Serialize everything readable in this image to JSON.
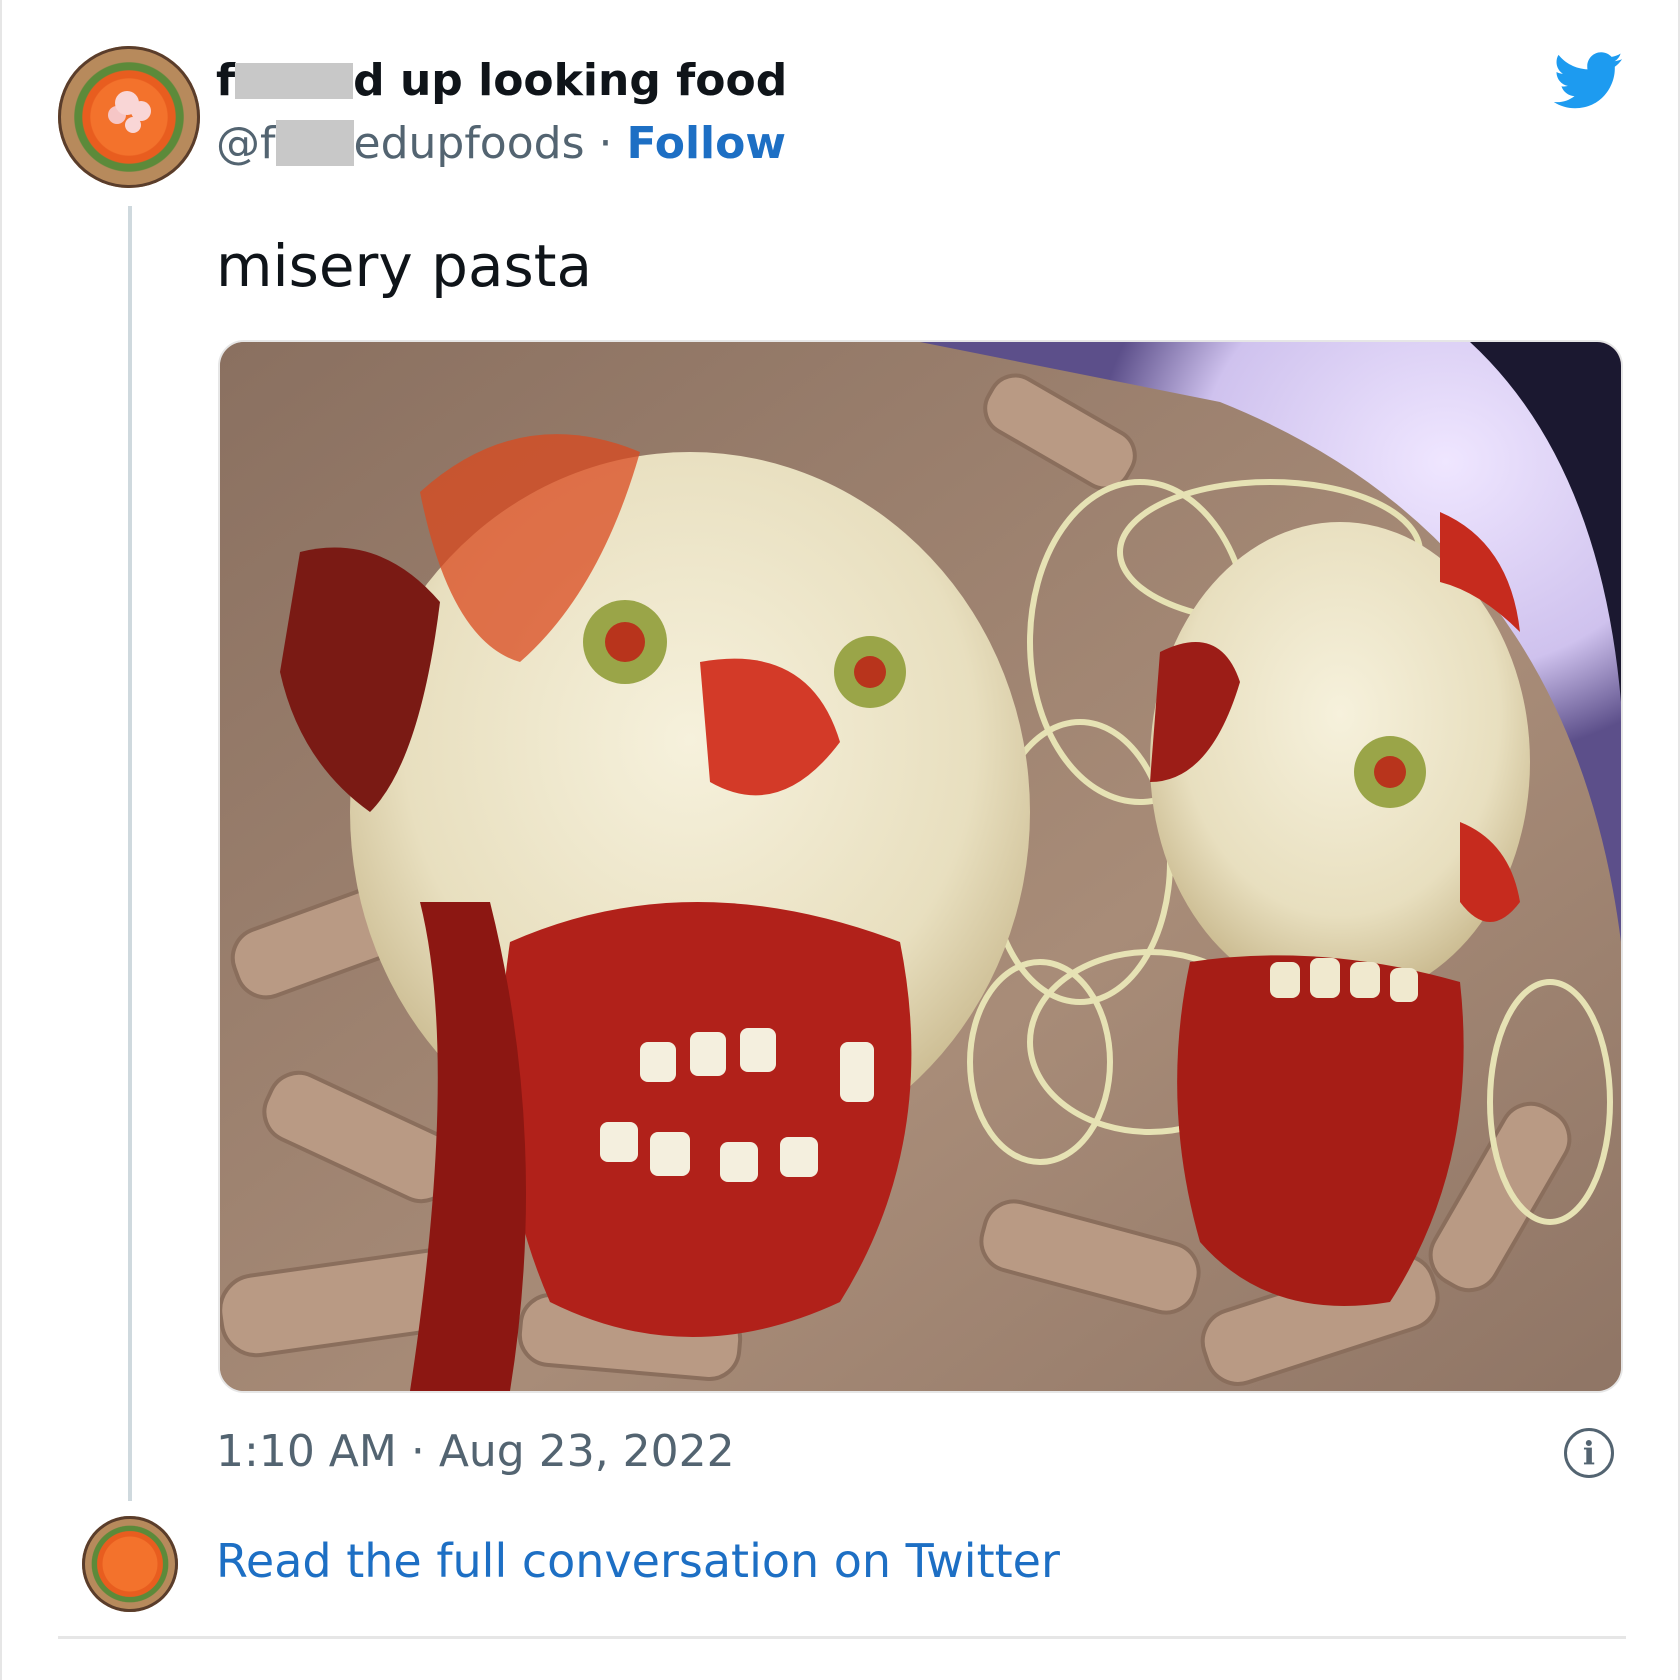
{
  "tweet": {
    "display_name_prefix": "f",
    "display_name_suffix": "d up looking food",
    "handle_prefix": "@f",
    "handle_suffix": "edupfoods",
    "separator": " · ",
    "follow_label": "Follow",
    "text": "misery pasta",
    "time": "1:10 AM · Aug 23, 2022",
    "info_glyph": "i",
    "read_full_label": "Read the full conversation on Twitter"
  },
  "icons": {
    "brand": "twitter-bird-icon",
    "info": "info-icon"
  },
  "colors": {
    "twitter_blue": "#1d9bf0",
    "link_blue": "#1d6fc4",
    "text_primary": "#0f1419",
    "text_secondary": "#536471"
  }
}
